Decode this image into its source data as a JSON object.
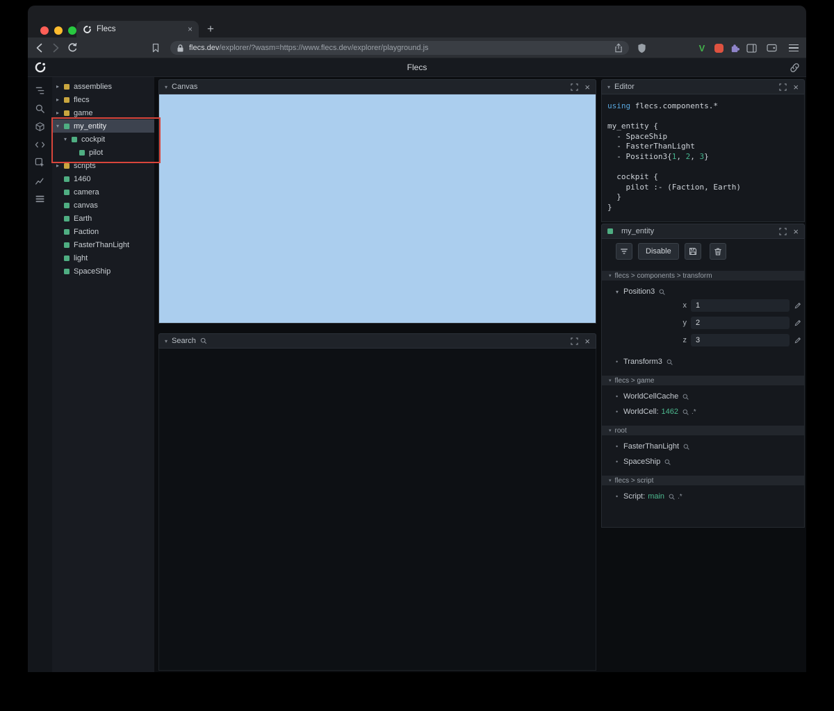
{
  "browser": {
    "tab_title": "Flecs",
    "url_domain": "flecs.dev",
    "url_path": "/explorer/?wasm=https://www.flecs.dev/explorer/playground.js",
    "extension_v": "V"
  },
  "app": {
    "title": "Flecs"
  },
  "icons": {
    "chevron_down": "▾",
    "chevron_right": "▸",
    "bullet": "•",
    "close": "×",
    "new_tab": "+"
  },
  "colors": {
    "entity_green": "#4fae82",
    "module_yellow": "#c9a63f",
    "canvas_blue": "#abceee",
    "annotation_red": "#d8453b",
    "value_green": "#4cb88e",
    "code_keyword_blue": "#58a6dd",
    "code_number_teal": "#45b48e"
  },
  "tree": {
    "items": [
      {
        "label": "assemblies",
        "type": "module",
        "state": "collapsed",
        "depth": 0
      },
      {
        "label": "flecs",
        "type": "module",
        "state": "collapsed",
        "depth": 0
      },
      {
        "label": "game",
        "type": "module",
        "state": "collapsed",
        "depth": 0
      },
      {
        "label": "my_entity",
        "type": "entity",
        "state": "expanded",
        "depth": 0,
        "selected": true
      },
      {
        "label": "cockpit",
        "type": "entity",
        "state": "expanded",
        "depth": 1
      },
      {
        "label": "pilot",
        "type": "entity",
        "state": "leaf",
        "depth": 2
      },
      {
        "label": "scripts",
        "type": "module",
        "state": "collapsed",
        "depth": 0
      },
      {
        "label": "1460",
        "type": "entity",
        "state": "leaf",
        "depth": 0
      },
      {
        "label": "camera",
        "type": "entity",
        "state": "leaf",
        "depth": 0
      },
      {
        "label": "canvas",
        "type": "entity",
        "state": "leaf",
        "depth": 0
      },
      {
        "label": "Earth",
        "type": "entity",
        "state": "leaf",
        "depth": 0
      },
      {
        "label": "Faction",
        "type": "entity",
        "state": "leaf",
        "depth": 0
      },
      {
        "label": "FasterThanLight",
        "type": "entity",
        "state": "leaf",
        "depth": 0
      },
      {
        "label": "light",
        "type": "entity",
        "state": "leaf",
        "depth": 0
      },
      {
        "label": "SpaceShip",
        "type": "entity",
        "state": "leaf",
        "depth": 0
      }
    ]
  },
  "panels": {
    "canvas": {
      "title": "Canvas"
    },
    "search": {
      "title": "Search"
    },
    "editor": {
      "title": "Editor",
      "lines": [
        [
          {
            "t": "using ",
            "c": "kw"
          },
          {
            "t": "flecs.components.*",
            "c": "pl"
          }
        ],
        [],
        [
          {
            "t": "my_entity {",
            "c": "pl"
          }
        ],
        [
          {
            "t": "  - SpaceShip",
            "c": "pl"
          }
        ],
        [
          {
            "t": "  - FasterThanLight",
            "c": "pl"
          }
        ],
        [
          {
            "t": "  - Position3{",
            "c": "pl"
          },
          {
            "t": "1",
            "c": "num"
          },
          {
            "t": ", ",
            "c": "pl"
          },
          {
            "t": "2",
            "c": "num"
          },
          {
            "t": ", ",
            "c": "pl"
          },
          {
            "t": "3",
            "c": "num"
          },
          {
            "t": "}",
            "c": "pl"
          }
        ],
        [],
        [
          {
            "t": "  cockpit {",
            "c": "pl"
          }
        ],
        [
          {
            "t": "    pilot :- (Faction, Earth)",
            "c": "pl"
          }
        ],
        [
          {
            "t": "  }",
            "c": "pl"
          }
        ],
        [
          {
            "t": "}",
            "c": "pl"
          }
        ]
      ]
    },
    "inspector": {
      "title": "my_entity",
      "toolbar": {
        "disable": "Disable"
      },
      "sections": [
        {
          "path": "flecs > components > transform",
          "rows": [
            {
              "kind": "component-open",
              "label": "Position3",
              "fields": [
                {
                  "name": "x",
                  "value": "1"
                },
                {
                  "name": "y",
                  "value": "2"
                },
                {
                  "name": "z",
                  "value": "3"
                }
              ]
            },
            {
              "kind": "component",
              "label": "Transform3"
            }
          ]
        },
        {
          "path": "flecs > game",
          "rows": [
            {
              "kind": "component",
              "label": "WorldCellCache"
            },
            {
              "kind": "pair",
              "label": "WorldCell:",
              "value": "1462",
              "suffix": ".*"
            }
          ]
        },
        {
          "path": "root",
          "rows": [
            {
              "kind": "component",
              "label": "FasterThanLight"
            },
            {
              "kind": "component",
              "label": "SpaceShip"
            }
          ]
        },
        {
          "path": "flecs > script",
          "rows": [
            {
              "kind": "pair",
              "label": "Script:",
              "value": "main",
              "suffix": ".*"
            }
          ]
        }
      ]
    }
  }
}
